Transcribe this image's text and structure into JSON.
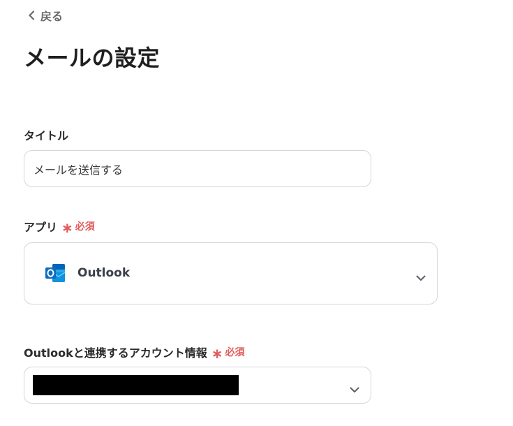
{
  "nav": {
    "back_label": "戻る"
  },
  "page": {
    "title": "メールの設定"
  },
  "title_field": {
    "label": "タイトル",
    "value": "メールを送信する"
  },
  "app_field": {
    "label": "アプリ",
    "required_label": "必須",
    "selected_app": "Outlook",
    "icon": "outlook-icon"
  },
  "account_field": {
    "label": "Outlookと連携するアカウント情報",
    "required_label": "必須"
  },
  "colors": {
    "required": "#e35b5b",
    "outlook_blue": "#0f6cbd",
    "border": "#d4d6dc"
  }
}
